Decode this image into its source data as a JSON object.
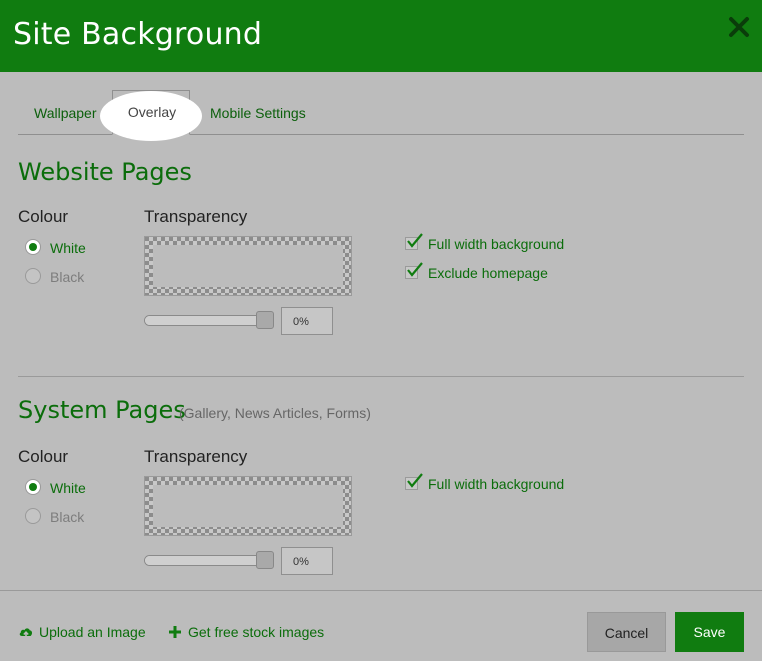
{
  "dialog": {
    "title": "Site Background"
  },
  "tabs": [
    {
      "label": "Wallpaper",
      "active": false
    },
    {
      "label": "Overlay",
      "active": true
    },
    {
      "label": "Mobile Settings",
      "active": false
    }
  ],
  "website_pages": {
    "title": "Website Pages",
    "colour_label": "Colour",
    "colour_options": [
      {
        "label": "White",
        "selected": true
      },
      {
        "label": "Black",
        "selected": false
      }
    ],
    "transparency_label": "Transparency",
    "transparency_value": "0%",
    "slider_fraction": 1.0,
    "checkboxes": [
      {
        "label": "Full width background",
        "checked": true
      },
      {
        "label": "Exclude homepage",
        "checked": true
      }
    ]
  },
  "system_pages": {
    "title": "System Pages",
    "subtitle": "(Gallery, News Articles, Forms)",
    "colour_label": "Colour",
    "colour_options": [
      {
        "label": "White",
        "selected": true
      },
      {
        "label": "Black",
        "selected": false
      }
    ],
    "transparency_label": "Transparency",
    "transparency_value": "0%",
    "slider_fraction": 1.0,
    "checkboxes": [
      {
        "label": "Full width background",
        "checked": true
      }
    ]
  },
  "footer": {
    "upload_label": "Upload an Image",
    "upload_icon": "upload-cloud-icon",
    "stock_label": "Get free stock images",
    "stock_icon": "plus-icon",
    "cancel_label": "Cancel",
    "save_label": "Save"
  },
  "colors": {
    "brand_green": "#107c10",
    "text_green": "#0b6d0b",
    "background": "#bcbcbc"
  }
}
